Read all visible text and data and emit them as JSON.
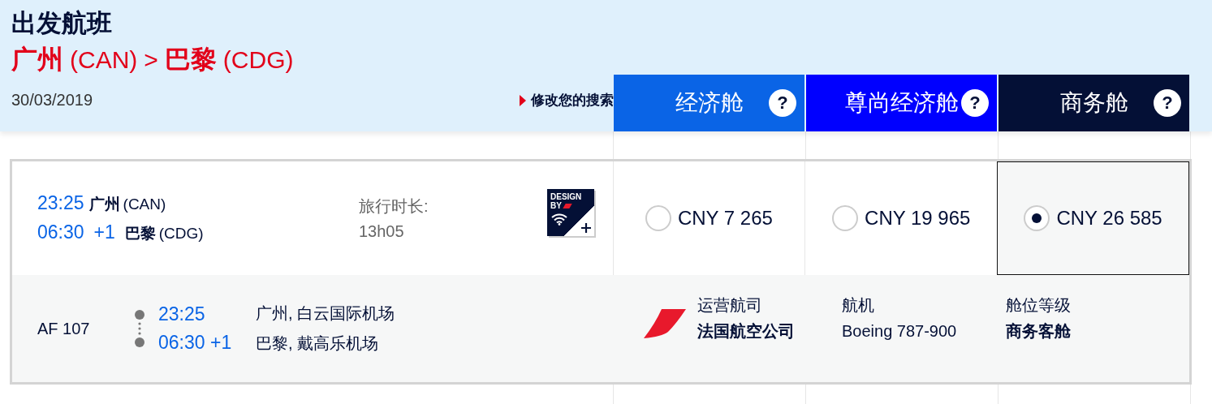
{
  "header": {
    "title": "出发航班",
    "route": {
      "origin_city": "广州",
      "origin_code": "(CAN)",
      "separator": ">",
      "dest_city": "巴黎",
      "dest_code": "(CDG)"
    },
    "date": "30/03/2019",
    "modify_link": "修改您的搜索"
  },
  "cabin_tabs": [
    {
      "label": "经济舱",
      "help": "?",
      "color": "#0a64e6"
    },
    {
      "label": "尊尚经济舱",
      "help": "?",
      "color": "#0000ff"
    },
    {
      "label": "商务舱",
      "help": "?",
      "color": "#041036"
    }
  ],
  "flight": {
    "departure_time": "23:25",
    "departure_city": "广州",
    "departure_code": "(CAN)",
    "arrival_time": "06:30",
    "day_offset": "+1",
    "arrival_city": "巴黎",
    "arrival_code": "(CDG)",
    "duration_label": "旅行时长:",
    "duration": "13h05",
    "badge": [
      "DESIGN",
      "BY"
    ]
  },
  "fares": [
    {
      "price": "CNY 7 265",
      "selected": false
    },
    {
      "price": "CNY 19 965",
      "selected": false
    },
    {
      "price": "CNY 26 585",
      "selected": true
    }
  ],
  "details": {
    "flight_number": "AF 107",
    "departure_time": "23:25",
    "arrival_time": "06:30 +1",
    "departure_airport": "广州, 白云国际机场",
    "arrival_airport": "巴黎, 戴高乐机场",
    "operator_label": "运营航司",
    "operator": "法国航空公司",
    "aircraft_label": "航机",
    "aircraft": "Boeing 787-900",
    "cabin_label": "舱位等级",
    "cabin": "商务客舱"
  }
}
